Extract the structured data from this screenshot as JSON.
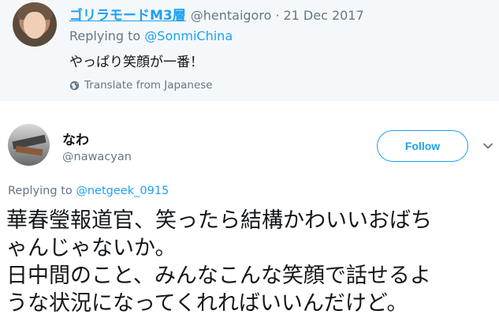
{
  "reply_tweet": {
    "display_name": "ゴリラモードM3層",
    "handle": "@hentaigoro",
    "separator": "·",
    "date": "21 Dec 2017",
    "replying_prefix": "Replying to",
    "replying_to": "@SonmiChina",
    "text": "やっぱり笑顔が一番！",
    "translate_label": "Translate from Japanese"
  },
  "main_tweet": {
    "display_name": "なわ",
    "handle": "@nawacyan",
    "follow_label": "Follow",
    "replying_prefix": "Replying to",
    "replying_to": "@netgeek_0915",
    "text": "華春瑩報道官、笑ったら結構かわいいおばち\nゃんじゃないか。\n日中間のこと、みんなこんな笑顔で話せるよ\nうな状況になってくれればいいんだけど。"
  },
  "colors": {
    "accent": "#1da1f2",
    "muted": "#657786",
    "text": "#14171a",
    "card_background": "#f5f8fa"
  },
  "icons": {
    "translate": "globe-icon",
    "menu": "chevron-down-icon"
  }
}
